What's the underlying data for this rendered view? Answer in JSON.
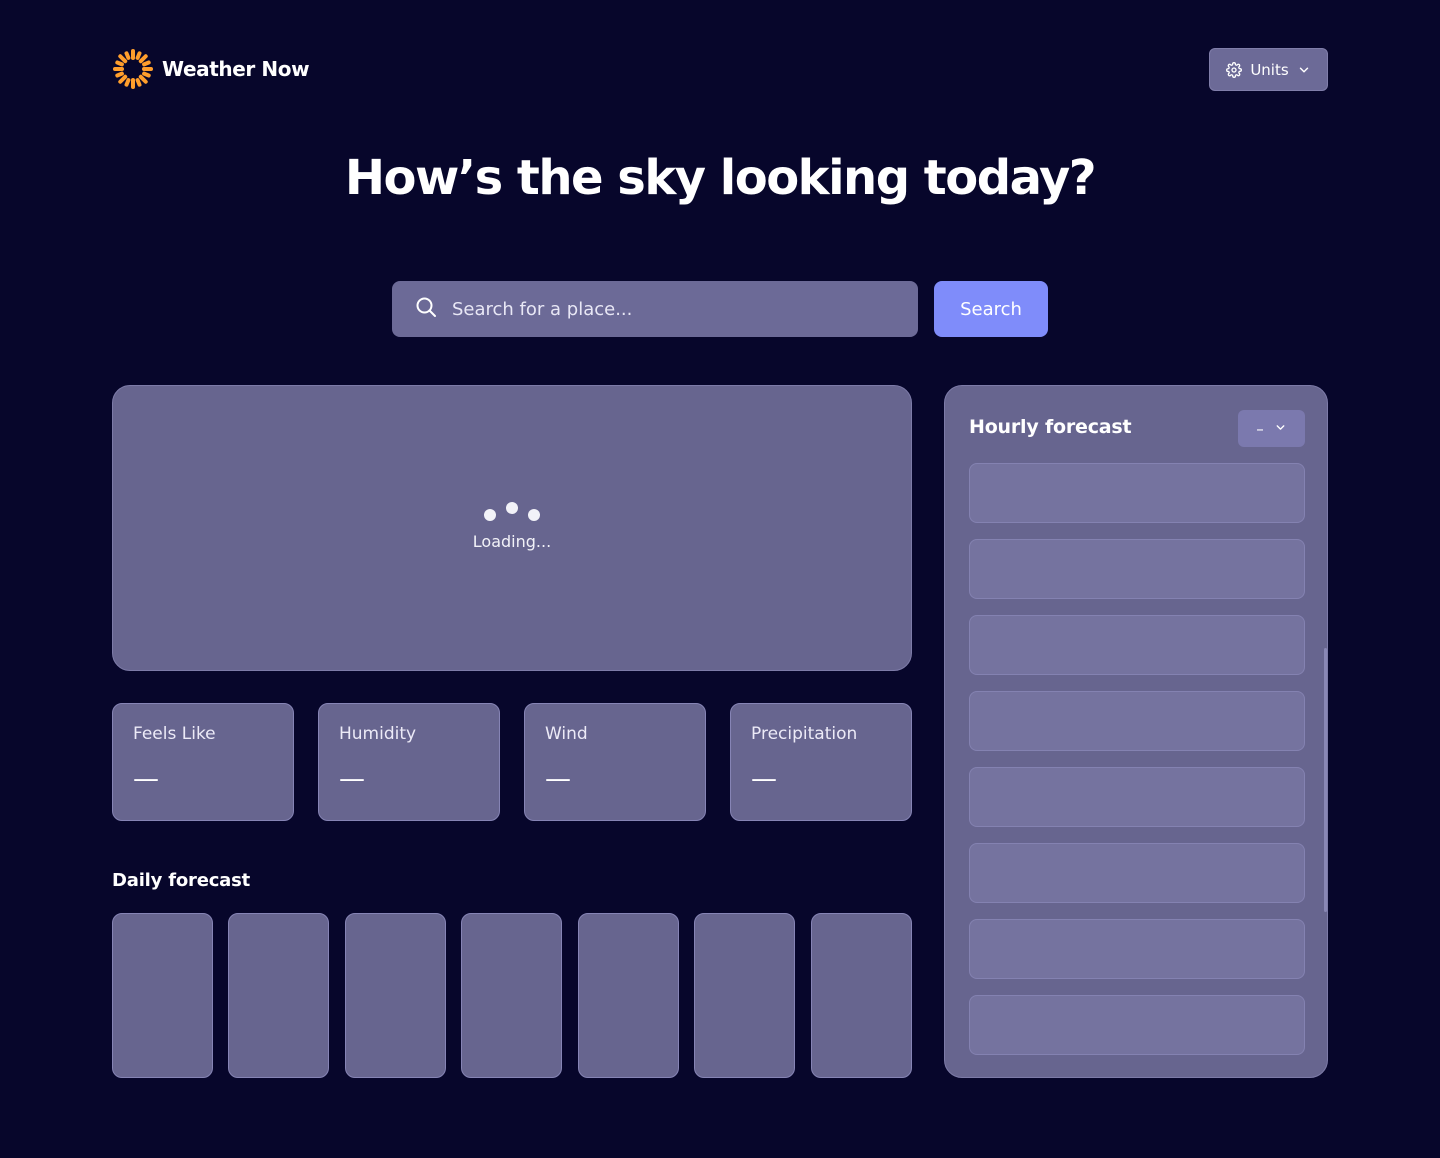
{
  "app": {
    "name": "Weather Now",
    "logo_icon": "sun-icon",
    "accent_color": "#ff9e2c"
  },
  "header": {
    "units_label": "Units",
    "units_icon": "gear-icon"
  },
  "hero": {
    "headline": "How’s the sky looking today?"
  },
  "search": {
    "placeholder": "Search for a place...",
    "button_label": "Search",
    "button_color": "#7f8cfa"
  },
  "current": {
    "loading_text": "Loading..."
  },
  "stats": [
    {
      "label": "Feels Like",
      "value": "—"
    },
    {
      "label": "Humidity",
      "value": "—"
    },
    {
      "label": "Wind",
      "value": "—"
    },
    {
      "label": "Precipitation",
      "value": "—"
    }
  ],
  "daily": {
    "title": "Daily forecast"
  },
  "hourly": {
    "title": "Hourly forecast",
    "day_selected": "–"
  }
}
